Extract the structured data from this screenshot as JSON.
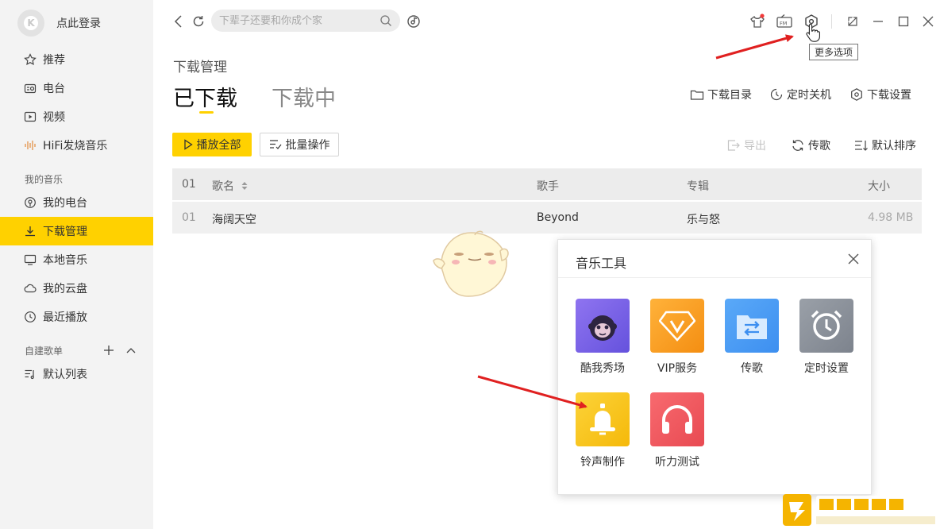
{
  "sidebar": {
    "user_name": "点此登录",
    "nav": [
      {
        "label": "推荐",
        "icon": "star-icon"
      },
      {
        "label": "电台",
        "icon": "radio-icon"
      },
      {
        "label": "视频",
        "icon": "video-icon"
      },
      {
        "label": "HiFi发烧音乐",
        "icon": "hifi-wave-icon"
      }
    ],
    "my_music_label": "我的音乐",
    "my_music": [
      {
        "label": "我的电台",
        "icon": "podcast-icon"
      },
      {
        "label": "下载管理",
        "icon": "download-icon",
        "active": true
      },
      {
        "label": "本地音乐",
        "icon": "monitor-icon"
      },
      {
        "label": "我的云盘",
        "icon": "cloud-icon"
      },
      {
        "label": "最近播放",
        "icon": "clock-icon"
      }
    ],
    "playlist_label": "自建歌单",
    "playlists": [
      {
        "label": "默认列表",
        "icon": "playlist-icon"
      }
    ]
  },
  "topbar": {
    "search_placeholder": "下辈子还要和你成个家",
    "tooltip": "更多选项"
  },
  "main": {
    "breadcrumb": "下载管理",
    "tab_downloaded": "已下载",
    "tab_downloading": "下载中",
    "header_actions": {
      "folder": "下载目录",
      "timer": "定时关机",
      "settings": "下载设置"
    },
    "toolbar": {
      "play_all": "播放全部",
      "batch": "批量操作",
      "export": "导出",
      "transfer": "传歌",
      "sort": "默认排序"
    },
    "table": {
      "headers": {
        "index": "01",
        "song": "歌名",
        "artist": "歌手",
        "album": "专辑",
        "size": "大小"
      },
      "rows": [
        {
          "index": "01",
          "song": "海阔天空",
          "artist": "Beyond",
          "album": "乐与怒",
          "size": "4.98 MB"
        }
      ]
    }
  },
  "popup": {
    "title": "音乐工具",
    "tools": [
      {
        "label": "酷我秀场",
        "color": "#7d63ea"
      },
      {
        "label": "VIP服务",
        "color": "#f7a21b"
      },
      {
        "label": "传歌",
        "color": "#4c9ef5"
      },
      {
        "label": "定时设置",
        "color": "#8e949e"
      },
      {
        "label": "铃声制作",
        "color": "#f9c517"
      },
      {
        "label": "听力测试",
        "color": "#f0545b"
      }
    ]
  },
  "colors": {
    "accent": "#ffd100",
    "arrow": "#e02020"
  }
}
